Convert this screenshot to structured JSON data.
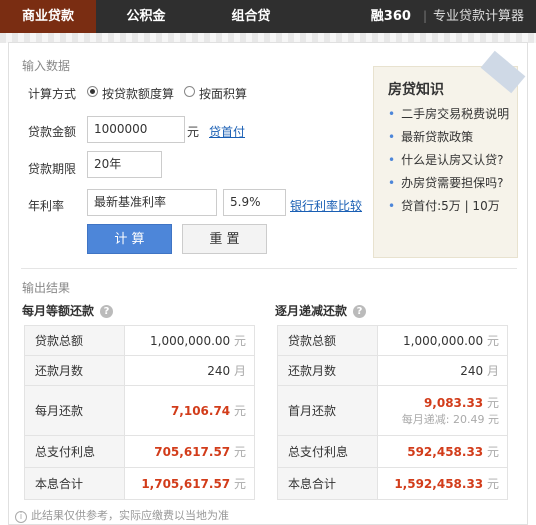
{
  "tabs": [
    {
      "label": "商业贷款"
    },
    {
      "label": "公积金"
    },
    {
      "label": "组合贷"
    }
  ],
  "brand": {
    "logo": "融360",
    "title": "专业贷款计算器"
  },
  "input_section": {
    "heading": "输入数据",
    "calc_method_label": "计算方式",
    "radio_amount": "按贷款额度算",
    "radio_area": "按面积算",
    "loan_amount_label": "贷款金额",
    "loan_amount_value": "1000000",
    "loan_amount_unit": "元",
    "down_payment_link": "贷首付",
    "term_label": "贷款期限",
    "term_value": "20年",
    "rate_label": "年利率",
    "rate_select": "最新基准利率",
    "rate_value": "5.9%",
    "rate_compare_link": "银行利率比较",
    "calc_button": "计 算",
    "reset_button": "重 置"
  },
  "knowledge": {
    "title": "房贷知识",
    "items": [
      {
        "label": "二手房交易税费说明"
      },
      {
        "label": "最新贷款政策"
      },
      {
        "label": "什么是认房又认贷?"
      },
      {
        "label": "办房贷需要担保吗?"
      },
      {
        "label": "贷首付:5万 | 10万"
      }
    ]
  },
  "output_section": {
    "heading": "输出结果",
    "equal_payment": {
      "title": "每月等额还款",
      "rows": [
        {
          "label": "贷款总额",
          "value": "1,000,000.00",
          "unit": "元"
        },
        {
          "label": "还款月数",
          "value": "240",
          "unit": "月"
        },
        {
          "label": "每月还款",
          "value": "7,106.74",
          "unit": "元"
        },
        {
          "label": "总支付利息",
          "value": "705,617.57",
          "unit": "元"
        },
        {
          "label": "本息合计",
          "value": "1,705,617.57",
          "unit": "元"
        }
      ]
    },
    "equal_principal": {
      "title": "逐月递减还款",
      "rows": [
        {
          "label": "贷款总额",
          "value": "1,000,000.00",
          "unit": "元"
        },
        {
          "label": "还款月数",
          "value": "240",
          "unit": "月"
        },
        {
          "label": "首月还款",
          "value": "9,083.33",
          "unit": "元",
          "sub_label": "每月递减:",
          "sub_value": "20.49",
          "sub_unit": "元"
        },
        {
          "label": "总支付利息",
          "value": "592,458.33",
          "unit": "元"
        },
        {
          "label": "本息合计",
          "value": "1,592,458.33",
          "unit": "元"
        }
      ]
    },
    "disclaimer": "此结果仅供参考，实际应缴费以当地为准"
  },
  "colors": {
    "accent": "#4d86d9",
    "highlight": "#d23c1a",
    "active_tab": "#7a2d12"
  }
}
